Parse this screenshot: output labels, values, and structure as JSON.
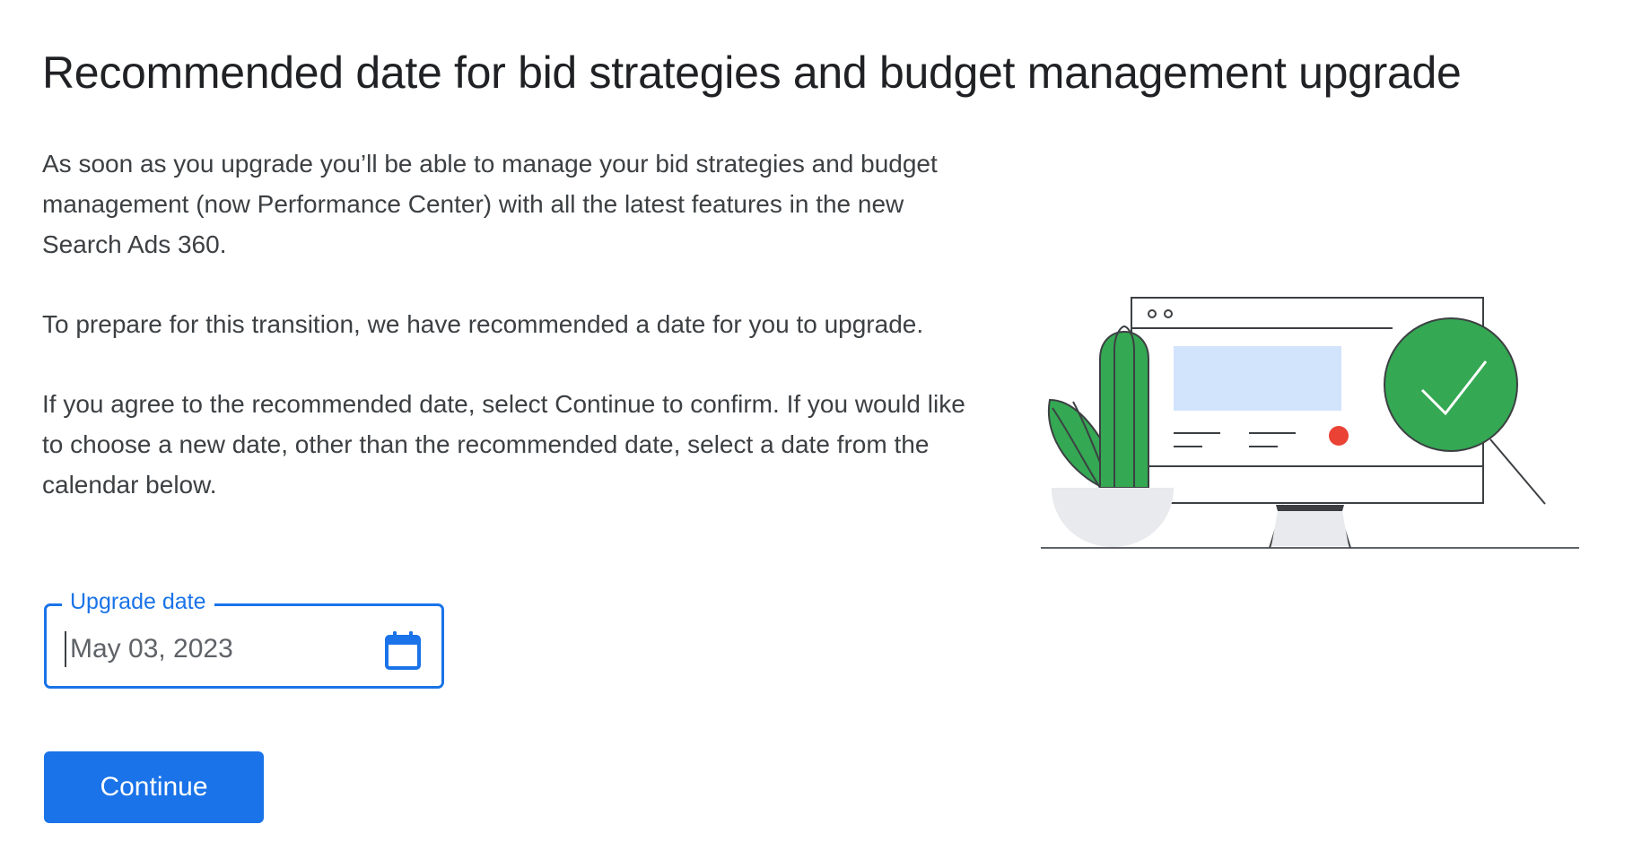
{
  "page": {
    "title": "Recommended date for bid strategies and budget management upgrade"
  },
  "content": {
    "paragraphs": [
      "As soon as you upgrade you’ll be able to manage your bid strategies and budget management (now Performance Center) with all the latest features in the new Search Ads 360.",
      "To prepare for this transition, we have recommended a date for you to upgrade.",
      "If you  agree to the recommended date, select Continue to confirm. If you would like to choose a new date, other than the recommended date, select a date from the calendar below."
    ]
  },
  "upgrade_date": {
    "label": "Upgrade date",
    "value": "May 03, 2023",
    "icon": "calendar-icon"
  },
  "actions": {
    "continue_label": "Continue"
  },
  "illustration": {
    "icons": [
      "plant-icon",
      "monitor-icon",
      "checkmark-magnifier-icon"
    ]
  },
  "colors": {
    "accent": "#1a73e8",
    "check_green": "#34a853",
    "highlight_red": "#ea4335",
    "placeholder_blue": "#d2e3fc"
  }
}
